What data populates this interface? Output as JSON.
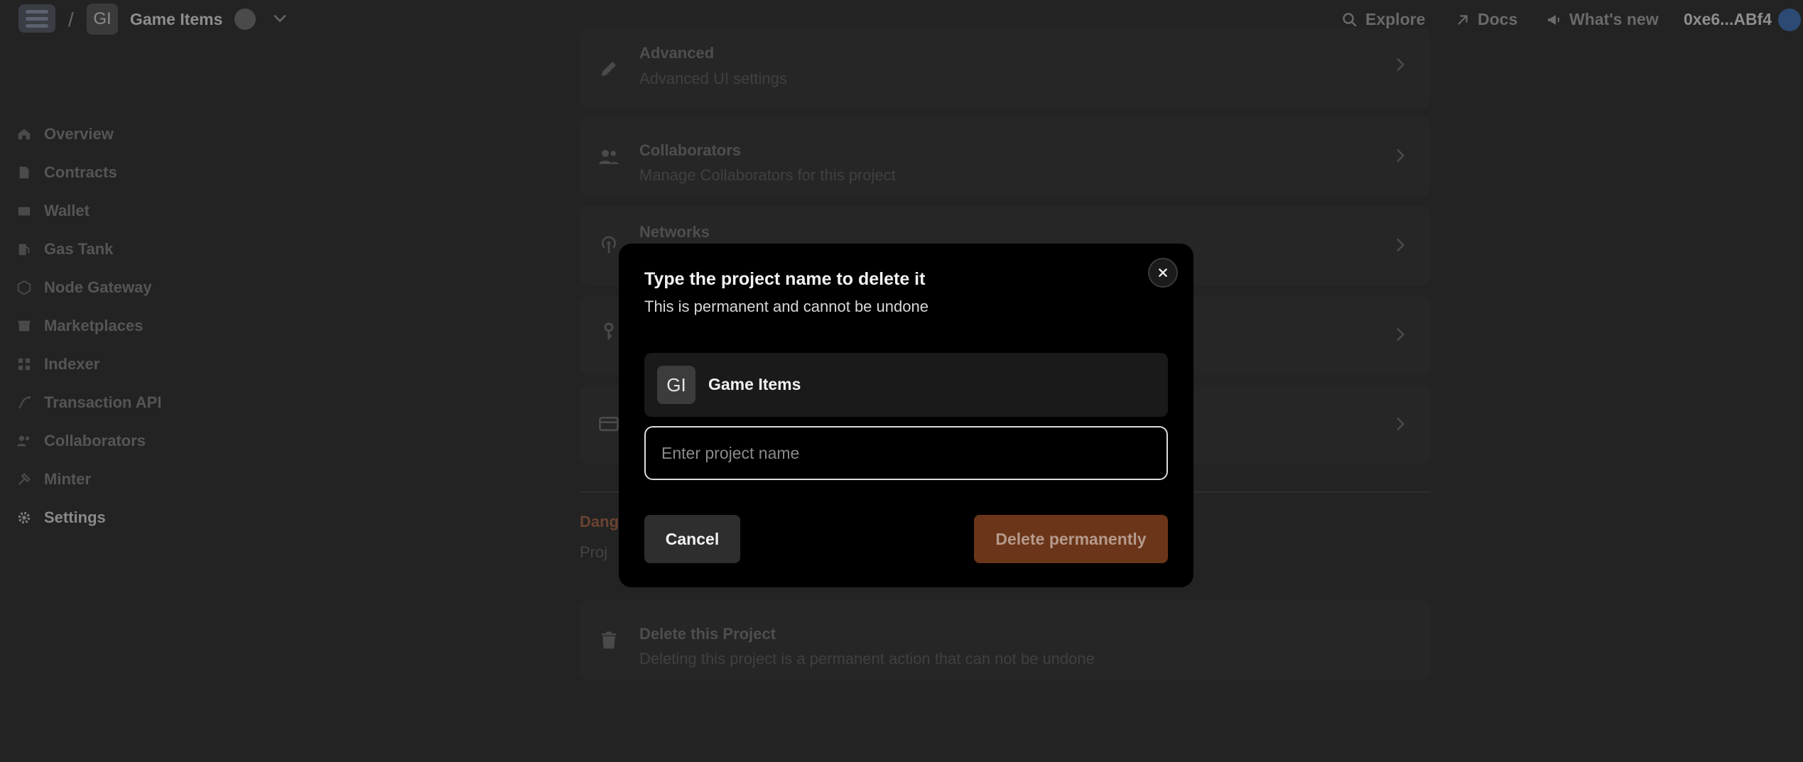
{
  "topbar": {
    "separator": "/",
    "project_badge": "GI",
    "project_name": "Game Items",
    "explore": "Explore",
    "docs": "Docs",
    "whats_new": "What's new",
    "address": "0xe6...ABf4"
  },
  "sidebar": {
    "items": [
      {
        "label": "Overview",
        "icon": "home-icon"
      },
      {
        "label": "Contracts",
        "icon": "contract-icon"
      },
      {
        "label": "Wallet",
        "icon": "wallet-icon"
      },
      {
        "label": "Gas Tank",
        "icon": "gas-icon"
      },
      {
        "label": "Node Gateway",
        "icon": "cube-icon"
      },
      {
        "label": "Marketplaces",
        "icon": "store-icon"
      },
      {
        "label": "Indexer",
        "icon": "indexer-icon"
      },
      {
        "label": "Transaction API",
        "icon": "transaction-icon"
      },
      {
        "label": "Collaborators",
        "icon": "people-icon"
      },
      {
        "label": "Minter",
        "icon": "minter-icon"
      },
      {
        "label": "Settings",
        "icon": "gear-icon",
        "active": true
      }
    ]
  },
  "settings": {
    "advanced": {
      "title": "Advanced",
      "subtitle": "Advanced UI settings"
    },
    "collaborators": {
      "title": "Collaborators",
      "subtitle": "Manage Collaborators for this project"
    },
    "networks": {
      "title": "Networks"
    },
    "danger_title": "Dang",
    "danger_sub": "Proj",
    "delete_project": {
      "title": "Delete this Project",
      "subtitle": "Deleting this project is a permanent action that can not be undone"
    }
  },
  "modal": {
    "title": "Type the project name to delete it",
    "subtitle": "This is permanent and cannot be undone",
    "project_badge": "GI",
    "project_name": "Game Items",
    "input_placeholder": "Enter project name",
    "cancel_label": "Cancel",
    "delete_label": "Delete permanently"
  },
  "colors": {
    "background": "#232323",
    "modal": "#000000",
    "delete_button": "#6b3519",
    "danger_text": "#6b4330"
  }
}
